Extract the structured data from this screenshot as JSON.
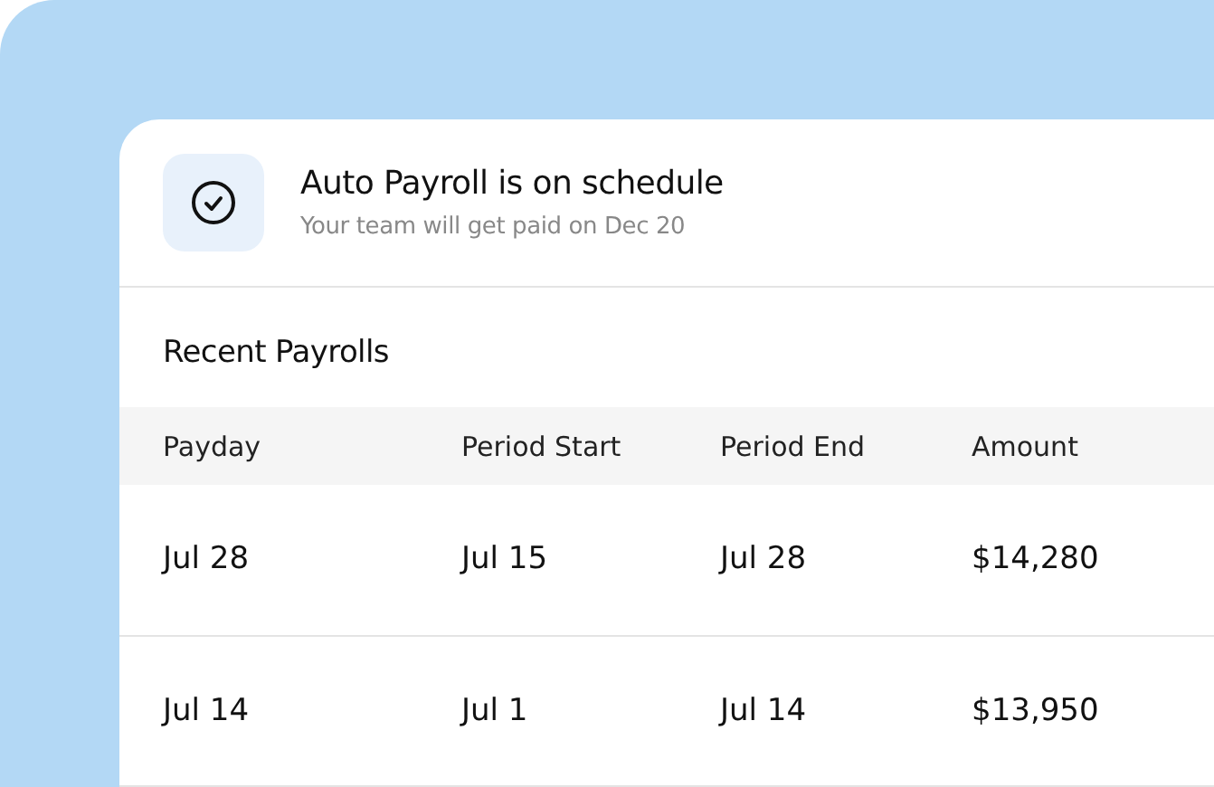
{
  "status": {
    "title": "Auto Payroll is on schedule",
    "subtitle": "Your team will get paid on Dec 20"
  },
  "section_title": "Recent Payrolls",
  "table": {
    "columns": [
      "Payday",
      "Period Start",
      "Period End",
      "Amount"
    ],
    "rows": [
      {
        "cells": [
          "Jul 28",
          "Jul 15",
          "Jul 28",
          "$14,280"
        ]
      },
      {
        "cells": [
          "Jul 14",
          "Jul 1",
          "Jul 14",
          "$13,950"
        ]
      }
    ]
  }
}
